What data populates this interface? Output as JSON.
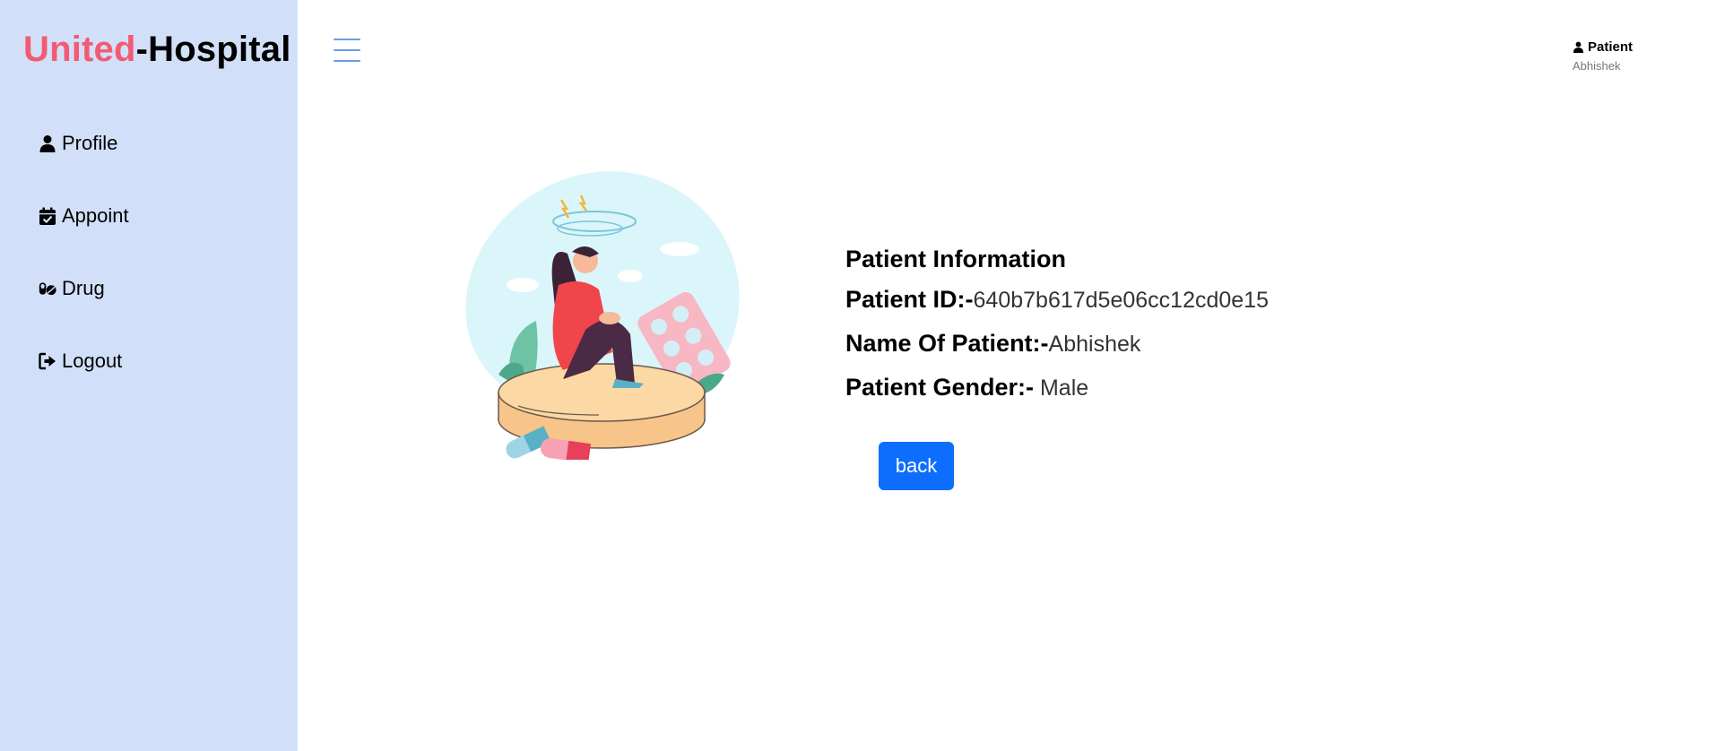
{
  "brand": {
    "part1": "United",
    "separator": "-",
    "part2": "Hospital"
  },
  "sidebar": {
    "items": [
      {
        "label": "Profile",
        "icon": "user-icon"
      },
      {
        "label": "Appoint",
        "icon": "calendar-check-icon"
      },
      {
        "label": "Drug",
        "icon": "pills-icon"
      },
      {
        "label": "Logout",
        "icon": "logout-icon"
      }
    ]
  },
  "header": {
    "menu_icon": "hamburger-icon",
    "user_role": "Patient",
    "user_name": "Abhishek"
  },
  "patient": {
    "title": "Patient Information",
    "id_label": "Patient ID:-",
    "id_value": "640b7b617d5e06cc12cd0e15",
    "name_label": "Name Of Patient:-",
    "name_value": "Abhishek",
    "gender_label": "Patient Gender:-",
    "gender_value": " Male"
  },
  "actions": {
    "back_label": "back"
  },
  "colors": {
    "accent": "#f25b74",
    "sidebar_bg": "#d1e0f8",
    "primary_button": "#0d6efd",
    "menu_icon": "#6d9be6"
  }
}
